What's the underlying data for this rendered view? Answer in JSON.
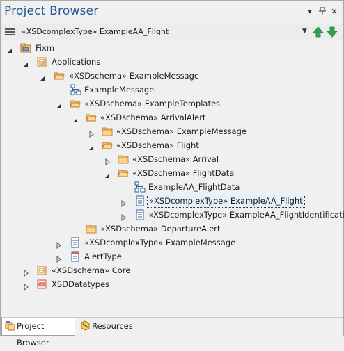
{
  "window": {
    "title": "Project Browser",
    "controls": [
      "▾",
      "⊞",
      "✕"
    ]
  },
  "toolbar": {
    "current_element": "«XSDcomplexType» ExampleAA_Flight"
  },
  "tree": {
    "rows": [
      {
        "label": "Fixm",
        "toggle": "expanded",
        "icon": "package-root-icon"
      },
      {
        "label": "Applications",
        "toggle": "expanded",
        "icon": "package-icon"
      },
      {
        "label": "«XSDschema» ExampleMessage",
        "toggle": "expanded",
        "icon": "folder-open-icon"
      },
      {
        "label": "ExampleMessage",
        "toggle": "none",
        "icon": "diagram-icon"
      },
      {
        "label": "«XSDschema» ExampleTemplates",
        "toggle": "expanded",
        "icon": "folder-open-icon"
      },
      {
        "label": "«XSDschema» ArrivalAlert",
        "toggle": "expanded",
        "icon": "folder-open-icon"
      },
      {
        "label": "«XSDschema» ExampleMessage",
        "toggle": "collapsed",
        "icon": "folder-icon"
      },
      {
        "label": "«XSDschema» Flight",
        "toggle": "expanded",
        "icon": "folder-open-icon"
      },
      {
        "label": "«XSDschema» Arrival",
        "toggle": "collapsed",
        "icon": "folder-icon"
      },
      {
        "label": "«XSDschema» FlightData",
        "toggle": "expanded",
        "icon": "folder-open-icon"
      },
      {
        "label": "ExampleAA_FlightData",
        "toggle": "none",
        "icon": "diagram-icon"
      },
      {
        "label": "«XSDcomplexType» ExampleAA_Flight",
        "toggle": "collapsed",
        "icon": "class-icon",
        "selected": true
      },
      {
        "label": "«XSDcomplexType» ExampleAA_FlightIdentification",
        "toggle": "collapsed",
        "icon": "class-icon"
      },
      {
        "label": "«XSDschema» DepartureAlert",
        "toggle": "none",
        "icon": "folder-icon"
      },
      {
        "label": "«XSDcomplexType» ExampleMessage",
        "toggle": "collapsed",
        "icon": "class-icon"
      },
      {
        "label": "AlertType",
        "toggle": "collapsed",
        "icon": "enum-icon"
      },
      {
        "label": "«XSDschema» Core",
        "toggle": "collapsed",
        "icon": "package-icon"
      },
      {
        "label": "XSDDatatypes",
        "toggle": "collapsed",
        "icon": "package-red-icon"
      }
    ]
  },
  "tabs": [
    {
      "label": "Project Browser",
      "icon": "project-browser-icon",
      "active": true
    },
    {
      "label": "Resources",
      "icon": "resources-icon",
      "active": false
    }
  ],
  "colors": {
    "title": "#1f5b8f",
    "folder": "#f7c27a",
    "selection": "#e5f0fb",
    "arrow_green": "#2ea44f"
  }
}
